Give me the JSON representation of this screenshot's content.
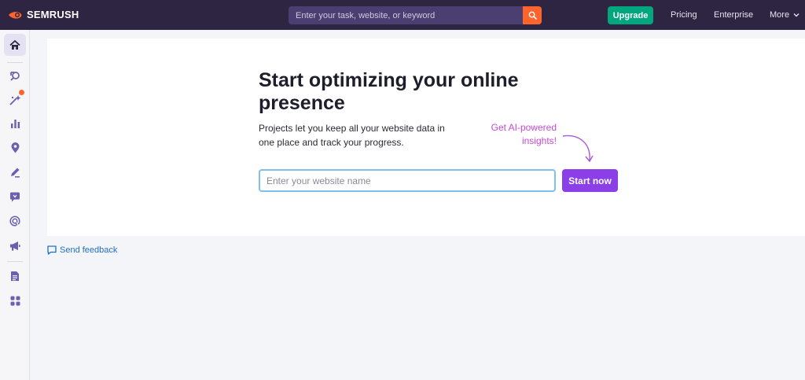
{
  "header": {
    "brand": "SEMRUSH",
    "search_placeholder": "Enter your task, website, or keyword",
    "upgrade_label": "Upgrade",
    "nav": [
      "Pricing",
      "Enterprise",
      "More"
    ]
  },
  "sidebar": {
    "items": [
      {
        "icon": "home-icon",
        "active": true
      },
      {
        "icon": "seo-icon"
      },
      {
        "icon": "ai-sparkle-icon",
        "badge": true
      },
      {
        "icon": "bar-chart-icon"
      },
      {
        "icon": "location-pin-icon"
      },
      {
        "icon": "content-pen-icon"
      },
      {
        "icon": "social-chat-icon"
      },
      {
        "icon": "ads-target-icon"
      },
      {
        "icon": "megaphone-icon"
      },
      {
        "icon": "report-document-icon"
      },
      {
        "icon": "apps-grid-icon"
      }
    ]
  },
  "main": {
    "headline": "Start optimizing your online presence",
    "description": "Projects let you keep all your website data in one place and track your progress.",
    "ai_note": "Get AI-powered insights!",
    "website_placeholder": "Enter your website name",
    "start_label": "Start now"
  },
  "footer": {
    "feedback_label": "Send feedback"
  },
  "colors": {
    "topbar": "#2d2541",
    "accent_orange": "#ff642d",
    "upgrade_green": "#00a67e",
    "start_purple": "#8b3fe6",
    "ai_pink": "#c24ad6",
    "sidebar_icon": "#6a5fb0"
  }
}
